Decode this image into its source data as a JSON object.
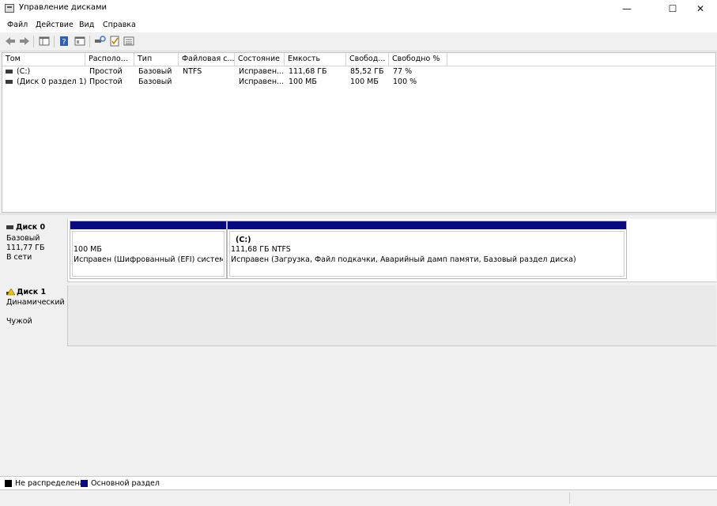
{
  "window": {
    "title": "Управление дисками",
    "minimize": "—",
    "maximize": "☐",
    "close": "✕"
  },
  "menu": [
    "Файл",
    "Действие",
    "Вид",
    "Справка"
  ],
  "toolbar": {
    "icons": [
      "back-icon",
      "forward-icon",
      "console-tree-icon",
      "help-icon",
      "properties-icon",
      "rescan-icon",
      "check-icon",
      "list-view-icon"
    ]
  },
  "columns": [
    "Том",
    "Располо...",
    "Тип",
    "Файловая с...",
    "Состояние",
    "Емкость",
    "Свобод...",
    "Свободно %"
  ],
  "volumes": [
    {
      "name": "(C:)",
      "layout": "Простой",
      "type": "Базовый",
      "fs": "NTFS",
      "status": "Исправен...",
      "capacity": "111,68 ГБ",
      "free": "85,52 ГБ",
      "free_pct": "77 %"
    },
    {
      "name": "(Диск 0 раздел 1)",
      "layout": "Простой",
      "type": "Базовый",
      "fs": "",
      "status": "Исправен...",
      "capacity": "100 МБ",
      "free": "100 МБ",
      "free_pct": "100 %"
    }
  ],
  "disks": [
    {
      "name": "Диск 0",
      "kind": "Базовый",
      "size": "111,77 ГБ",
      "state": "В сети",
      "partitions": [
        {
          "label": "",
          "size": "100 МБ",
          "status": "Исправен (Шифрованный (EFI) системны"
        },
        {
          "label": "(C:)",
          "size": "111,68 ГБ NTFS",
          "status": "Исправен (Загрузка, Файл подкачки, Аварийный дамп памяти, Базовый раздел диска)"
        }
      ]
    },
    {
      "name": "Диск 1",
      "kind": "Динамический",
      "state": "Чужой"
    }
  ],
  "legend": [
    {
      "label": "Не распределена",
      "color": "#000000"
    },
    {
      "label": "Основной раздел",
      "color": "#0a0a80"
    }
  ]
}
